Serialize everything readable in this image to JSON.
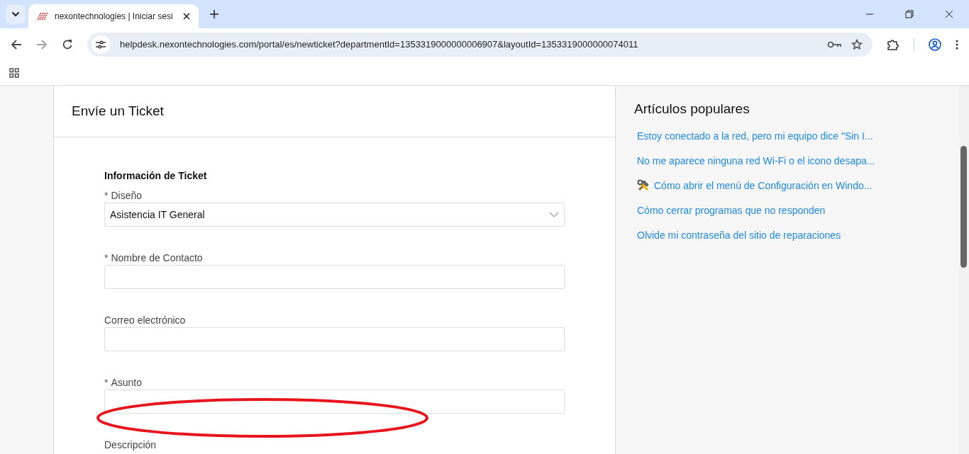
{
  "browser": {
    "tab_title": "nexontechnologies | Iniciar sesi",
    "url": "helpdesk.nexontechnologies.com/portal/es/newticket?departmentId=1353319000000006907&layoutId=1353319000000074011"
  },
  "form": {
    "title": "Envíe un Ticket",
    "section": "Información de Ticket",
    "fields": [
      {
        "kind": "select",
        "label": "Diseño",
        "required_mark": "*",
        "value": "Asistencia IT General"
      },
      {
        "kind": "text",
        "label": "Nombre de Contacto",
        "required_mark": "*"
      },
      {
        "kind": "text",
        "label": "Correo electrónico"
      },
      {
        "kind": "text",
        "label": "Asunto",
        "required_mark": "*"
      },
      {
        "kind": "label",
        "label": "Descripción"
      }
    ]
  },
  "sidebar": {
    "title": "Artículos populares",
    "articles": [
      {
        "kind": "plain",
        "title": "Estoy conectado a la red, pero mi equipo dice \"Sin I..."
      },
      {
        "kind": "plain",
        "title": "No me aparece ninguna red Wi-Fi o el icono desapa..."
      },
      {
        "kind": "tool",
        "title": "Cómo abrir el menú de Configuración en Windo..."
      },
      {
        "kind": "plain",
        "title": "Cómo cerrar programas que no responden"
      },
      {
        "kind": "plain",
        "title": "Olvide mi contraseña del sitio de reparaciones"
      }
    ]
  }
}
